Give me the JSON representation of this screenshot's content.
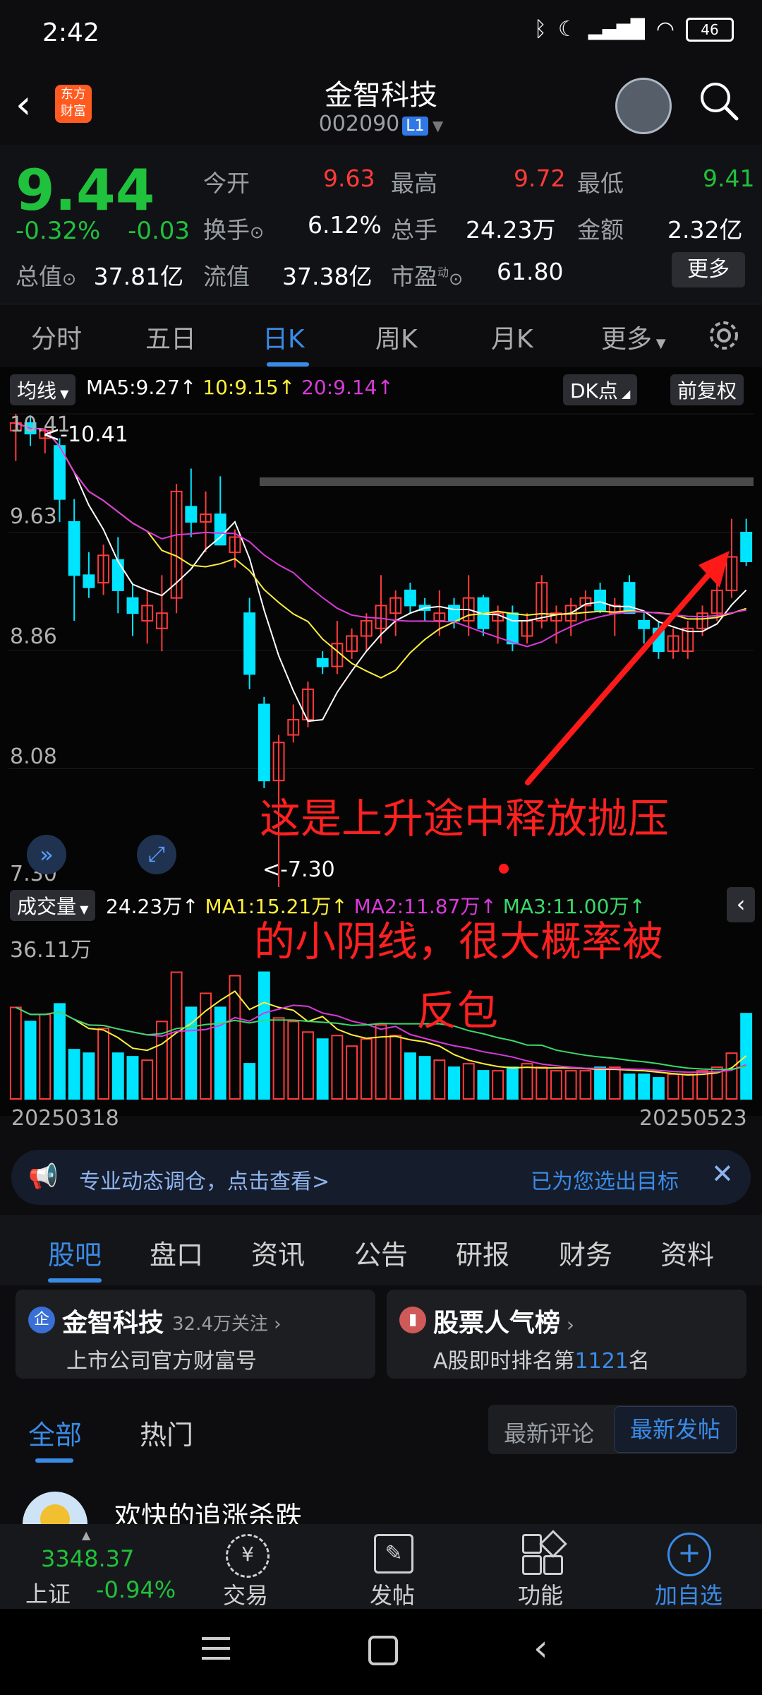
{
  "status_bar": {
    "time": "2:42",
    "battery": "46"
  },
  "header": {
    "title": "金智科技",
    "code": "002090",
    "code_badge": "L1",
    "logo_line1": "东方",
    "logo_line2": "财富"
  },
  "quote": {
    "price": "9.44",
    "change_pct": "-0.32%",
    "change_abs": "-0.03",
    "open_label": "今开",
    "open_value": "9.63",
    "high_label": "最高",
    "high_value": "9.72",
    "low_label": "最低",
    "low_value": "9.41",
    "turnover_label": "换手",
    "turnover_value": "6.12%",
    "volume_label": "总手",
    "volume_value": "24.23万",
    "amount_label": "金额",
    "amount_value": "2.32亿",
    "mktcap_label": "总值",
    "mktcap_value": "37.81亿",
    "float_label": "流值",
    "float_value": "37.38亿",
    "pe_label": "市盈",
    "pe_sup": "动",
    "pe_value": "61.80",
    "more_label": "更多"
  },
  "tabs": [
    "分时",
    "五日",
    "日K",
    "周K",
    "月K",
    "更多"
  ],
  "chart": {
    "ma_selector": "均线",
    "ma5": "MA5:9.27↑",
    "ma10": "10:9.15↑",
    "ma20": "20:9.14↑",
    "dk_label": "DK点",
    "adjust_label": "前复权",
    "y_ticks": [
      "10.41",
      "9.63",
      "8.86",
      "8.08",
      "7.30"
    ],
    "max_marker": "<-10.41",
    "min_marker": "<-7.30",
    "vol_selector": "成交量",
    "vol_value": "24.23万↑",
    "vol_ma1": "MA1:15.21万↑",
    "vol_ma2": "MA2:11.87万↑",
    "vol_ma3": "MA3:11.00万↑",
    "vol_max": "36.11万",
    "date_start": "20250318",
    "date_end": "20250523",
    "annotation_line1": "这是上升途中释放抛压",
    "annotation_line2": "的小阴线，很大概率被",
    "annotation_line3": "反包",
    "colors": {
      "up": "#ff3b3b",
      "down": "#00e5ff",
      "ma5": "#ffffff",
      "ma10": "#ffef3a",
      "ma20": "#d93ad9"
    }
  },
  "chart_data": {
    "type": "candlestick",
    "ylim": [
      7.3,
      10.41
    ],
    "candles": [
      {
        "o": 10.3,
        "h": 10.41,
        "l": 10.1,
        "c": 10.35
      },
      {
        "o": 10.35,
        "h": 10.4,
        "l": 10.2,
        "c": 10.28
      },
      {
        "o": 10.25,
        "h": 10.32,
        "l": 10.15,
        "c": 10.3
      },
      {
        "o": 10.2,
        "h": 10.25,
        "l": 9.7,
        "c": 9.85
      },
      {
        "o": 9.7,
        "h": 9.85,
        "l": 9.05,
        "c": 9.35
      },
      {
        "o": 9.35,
        "h": 9.5,
        "l": 9.2,
        "c": 9.27
      },
      {
        "o": 9.3,
        "h": 9.55,
        "l": 9.22,
        "c": 9.48
      },
      {
        "o": 9.45,
        "h": 9.6,
        "l": 9.1,
        "c": 9.25
      },
      {
        "o": 9.2,
        "h": 9.3,
        "l": 8.95,
        "c": 9.1
      },
      {
        "o": 9.05,
        "h": 9.25,
        "l": 8.9,
        "c": 9.15
      },
      {
        "o": 9.0,
        "h": 9.35,
        "l": 8.85,
        "c": 9.1
      },
      {
        "o": 9.2,
        "h": 9.95,
        "l": 9.1,
        "c": 9.9
      },
      {
        "o": 9.8,
        "h": 10.05,
        "l": 9.6,
        "c": 9.7
      },
      {
        "o": 9.7,
        "h": 9.9,
        "l": 9.5,
        "c": 9.75
      },
      {
        "o": 9.75,
        "h": 10.0,
        "l": 9.6,
        "c": 9.55
      },
      {
        "o": 9.5,
        "h": 9.65,
        "l": 9.4,
        "c": 9.6
      },
      {
        "o": 9.1,
        "h": 9.2,
        "l": 8.6,
        "c": 8.7
      },
      {
        "o": 8.5,
        "h": 8.55,
        "l": 7.95,
        "c": 8.0
      },
      {
        "o": 8.0,
        "h": 8.3,
        "l": 7.3,
        "c": 8.25
      },
      {
        "o": 8.3,
        "h": 8.5,
        "l": 8.25,
        "c": 8.4
      },
      {
        "o": 8.4,
        "h": 8.65,
        "l": 8.35,
        "c": 8.6
      },
      {
        "o": 8.8,
        "h": 8.85,
        "l": 8.7,
        "c": 8.75
      },
      {
        "o": 8.75,
        "h": 9.05,
        "l": 8.7,
        "c": 8.9
      },
      {
        "o": 8.85,
        "h": 9.0,
        "l": 8.8,
        "c": 8.95
      },
      {
        "o": 8.95,
        "h": 9.1,
        "l": 8.85,
        "c": 9.05
      },
      {
        "o": 9.0,
        "h": 9.35,
        "l": 8.9,
        "c": 9.15
      },
      {
        "o": 9.1,
        "h": 9.25,
        "l": 8.95,
        "c": 9.2
      },
      {
        "o": 9.25,
        "h": 9.3,
        "l": 9.1,
        "c": 9.15
      },
      {
        "o": 9.15,
        "h": 9.2,
        "l": 9.05,
        "c": 9.12
      },
      {
        "o": 9.05,
        "h": 9.25,
        "l": 8.95,
        "c": 9.1
      },
      {
        "o": 9.15,
        "h": 9.2,
        "l": 9.0,
        "c": 9.05
      },
      {
        "o": 9.05,
        "h": 9.35,
        "l": 8.95,
        "c": 9.2
      },
      {
        "o": 9.2,
        "h": 9.22,
        "l": 8.95,
        "c": 9.0
      },
      {
        "o": 9.05,
        "h": 9.15,
        "l": 8.9,
        "c": 9.1
      },
      {
        "o": 9.1,
        "h": 9.15,
        "l": 8.85,
        "c": 8.9
      },
      {
        "o": 8.95,
        "h": 9.1,
        "l": 8.9,
        "c": 9.05
      },
      {
        "o": 9.05,
        "h": 9.35,
        "l": 9.0,
        "c": 9.3
      },
      {
        "o": 9.05,
        "h": 9.15,
        "l": 8.9,
        "c": 9.1
      },
      {
        "o": 9.05,
        "h": 9.2,
        "l": 8.95,
        "c": 9.15
      },
      {
        "o": 9.15,
        "h": 9.25,
        "l": 9.05,
        "c": 9.2
      },
      {
        "o": 9.25,
        "h": 9.3,
        "l": 9.1,
        "c": 9.12
      },
      {
        "o": 9.1,
        "h": 9.2,
        "l": 8.95,
        "c": 9.15
      },
      {
        "o": 9.3,
        "h": 9.35,
        "l": 9.1,
        "c": 9.1
      },
      {
        "o": 9.05,
        "h": 9.1,
        "l": 8.9,
        "c": 9.0
      },
      {
        "o": 9.0,
        "h": 9.05,
        "l": 8.8,
        "c": 8.85
      },
      {
        "o": 8.85,
        "h": 9.0,
        "l": 8.8,
        "c": 8.95
      },
      {
        "o": 8.85,
        "h": 9.05,
        "l": 8.8,
        "c": 9.0
      },
      {
        "o": 9.0,
        "h": 9.15,
        "l": 8.95,
        "c": 9.1
      },
      {
        "o": 9.1,
        "h": 9.3,
        "l": 9.05,
        "c": 9.25
      },
      {
        "o": 9.25,
        "h": 9.72,
        "l": 9.2,
        "c": 9.47
      },
      {
        "o": 9.63,
        "h": 9.72,
        "l": 9.41,
        "c": 9.44
      }
    ],
    "volumes": [
      26,
      22,
      24,
      27,
      14,
      13,
      20,
      13,
      12,
      11,
      22,
      36,
      26,
      30,
      26,
      35,
      10,
      36,
      23,
      22,
      19,
      17,
      18,
      15,
      17,
      21,
      18,
      13,
      12,
      11,
      9,
      10,
      8,
      8,
      9,
      10,
      9,
      8,
      8,
      8,
      9,
      9,
      7,
      7,
      6,
      7,
      7,
      8,
      9,
      13,
      24.23
    ]
  },
  "marquee": {
    "left_text": "专业动态调仓，点击查看>",
    "right_text": "已为您选出目标"
  },
  "subtabs": [
    "股吧",
    "盘口",
    "资讯",
    "公告",
    "研报",
    "财务",
    "资料"
  ],
  "cards": {
    "company_badge": "企",
    "company_name": "金智科技",
    "company_followers": "32.4万关注",
    "company_sub": "上市公司官方财富号",
    "rank_title": "股票人气榜",
    "rank_sub_prefix": "A股即时排名第",
    "rank_num": "1121",
    "rank_sub_suffix": "名"
  },
  "community": {
    "tab_all": "全部",
    "tab_hot": "热门",
    "sort_latest_comment": "最新评论",
    "sort_latest_post": "最新发帖",
    "post_user": "欢快的追涨杀跌"
  },
  "bottom_nav": {
    "index_value": "3348.37",
    "index_name": "上证",
    "index_change": "-0.94%",
    "trade": "交易",
    "post": "发帖",
    "functions": "功能",
    "add_watch": "加自选"
  }
}
